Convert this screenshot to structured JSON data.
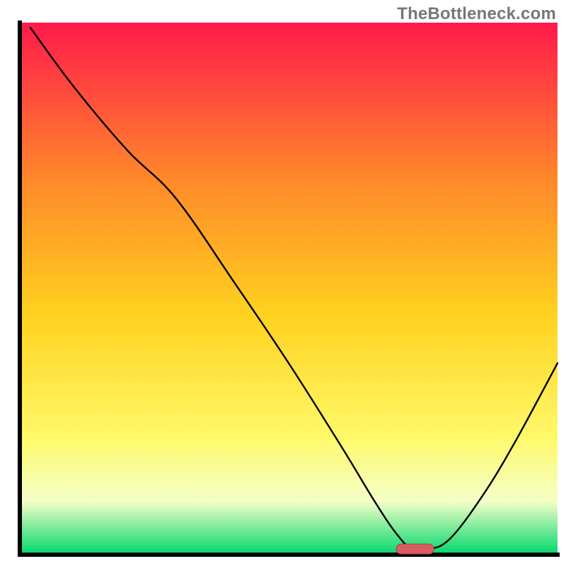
{
  "watermark": "TheBottleneck.com",
  "chart_data": {
    "type": "line",
    "title": "",
    "xlabel": "",
    "ylabel": "",
    "xlim": [
      0,
      100
    ],
    "ylim": [
      0,
      100
    ],
    "note": "Bottleneck curve over a red-to-green vertical gradient. Y is bottleneck percentage (100 at top, 0 at bottom). X is an unlabeled configuration axis (0 left, 100 right). Values are read off the plotted curve; no tick labels are shown.",
    "series": [
      {
        "name": "bottleneck",
        "x": [
          2,
          10,
          20,
          29,
          40,
          50,
          60,
          66,
          70,
          73,
          76,
          80,
          86,
          92,
          100
        ],
        "y": [
          99,
          88,
          76,
          67,
          51,
          36,
          20,
          10,
          4,
          1,
          1,
          3,
          11,
          21,
          36
        ]
      }
    ],
    "optimal_range_x": [
      70,
      77
    ],
    "colors": {
      "gradient_top": "#ff1a4b",
      "gradient_mid_upper": "#ff8a2a",
      "gradient_mid": "#ffd21f",
      "gradient_mid_lower": "#fff96a",
      "gradient_low": "#f4ffc8",
      "gradient_bottom": "#00d66b",
      "axis": "#000000",
      "curve": "#000000",
      "marker_fill": "#d95c63",
      "marker_stroke": "#b23a42"
    }
  }
}
